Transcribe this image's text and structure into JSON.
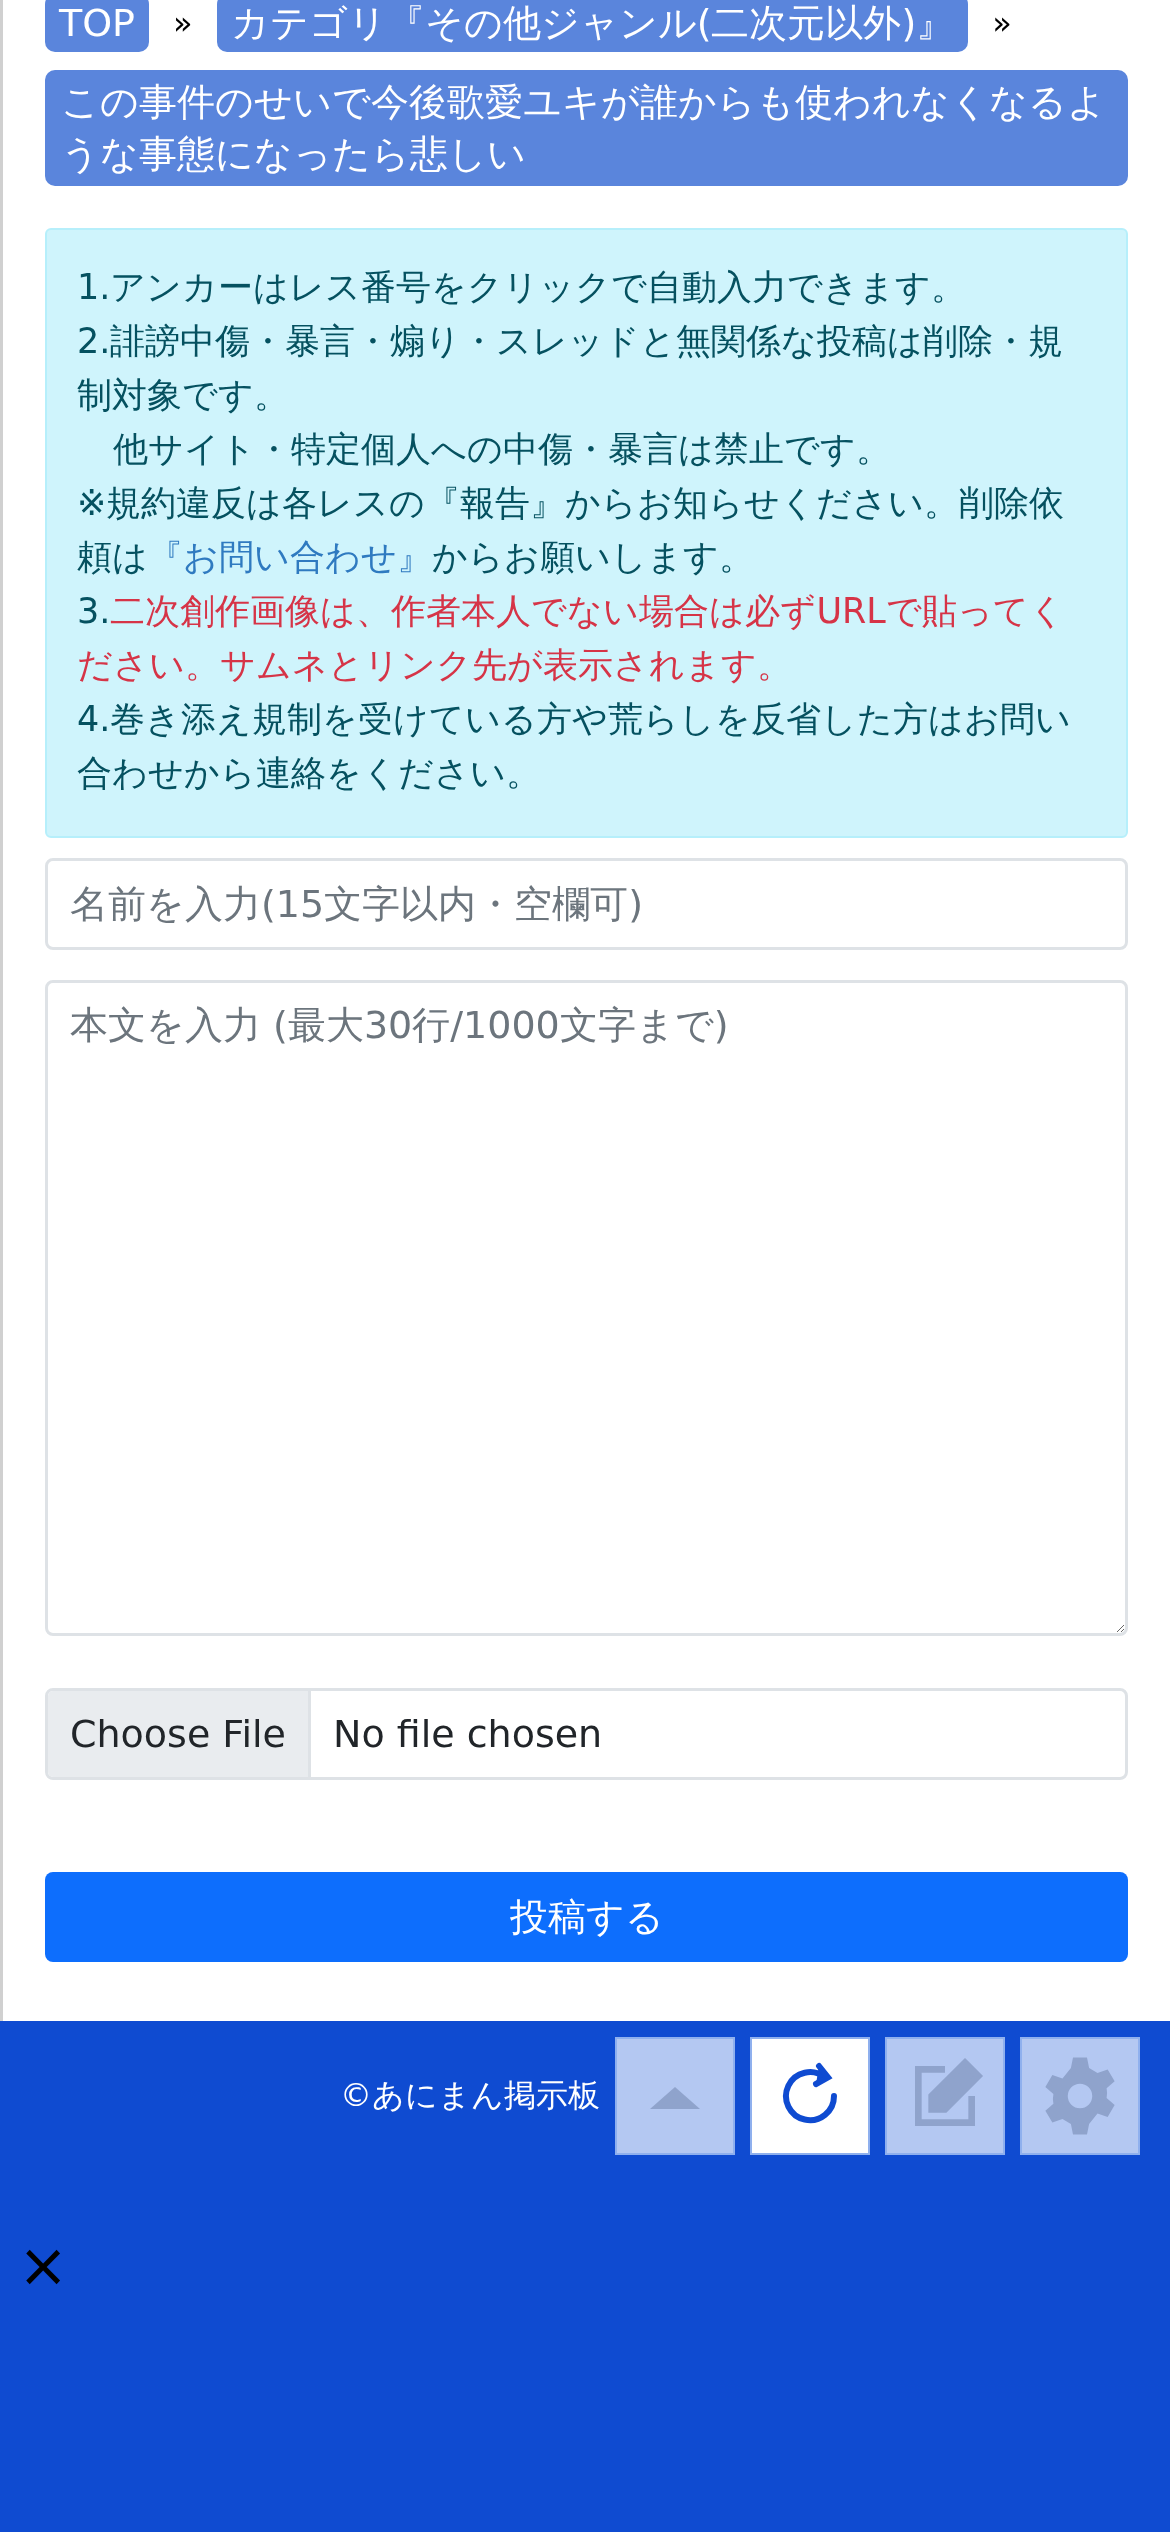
{
  "breadcrumb": [
    {
      "label": "TOP"
    },
    {
      "label": "カテゴリ『その他ジャンル(二次元以外)』"
    },
    {
      "label": "この事件のせいで今後歌愛ユキが誰からも使われなくなるような事態になったら悲しい"
    }
  ],
  "separator": "»",
  "notice": [
    {
      "kind": "plain",
      "text": "1.アンカーはレス番号をクリックで自動入力できます。"
    },
    {
      "kind": "plain",
      "text": "2.誹謗中傷・暴言・煽り・スレッドと無関係な投稿は削除・規制対象です。"
    },
    {
      "kind": "indented",
      "text": "他サイト・特定個人への中傷・暴言は禁止です。"
    },
    {
      "kind": "link",
      "before": "※規約違反は各レスの『報告』からお知らせください。削除依頼は",
      "link": "『お問い合わせ』",
      "after": "からお願いします。"
    },
    {
      "kind": "alert",
      "number": "3.",
      "text": "二次創作画像は、作者本人でない場合は必ずURLで貼ってください。サムネとリンク先が表示されます。"
    },
    {
      "kind": "plain",
      "text": "4.巻き添え規制を受けている方や荒らしを反省した方はお問い合わせから連絡をください。"
    }
  ],
  "name_field": {
    "placeholder": "名前を入力(15文字以内・空欄可)"
  },
  "body_field": {
    "placeholder": "本文を入力 (最大30行/1000文字まで)"
  },
  "file_field": {
    "button": "Choose File",
    "status": "No file chosen"
  },
  "submit": "投稿する",
  "footer": {
    "copyright": "©あにまん掲示板"
  },
  "floating_buttons": [
    {
      "kind": "top",
      "selected": false
    },
    {
      "kind": "reload",
      "selected": true
    },
    {
      "kind": "edit",
      "selected": false
    },
    {
      "kind": "settings",
      "selected": false
    }
  ],
  "close": "×"
}
